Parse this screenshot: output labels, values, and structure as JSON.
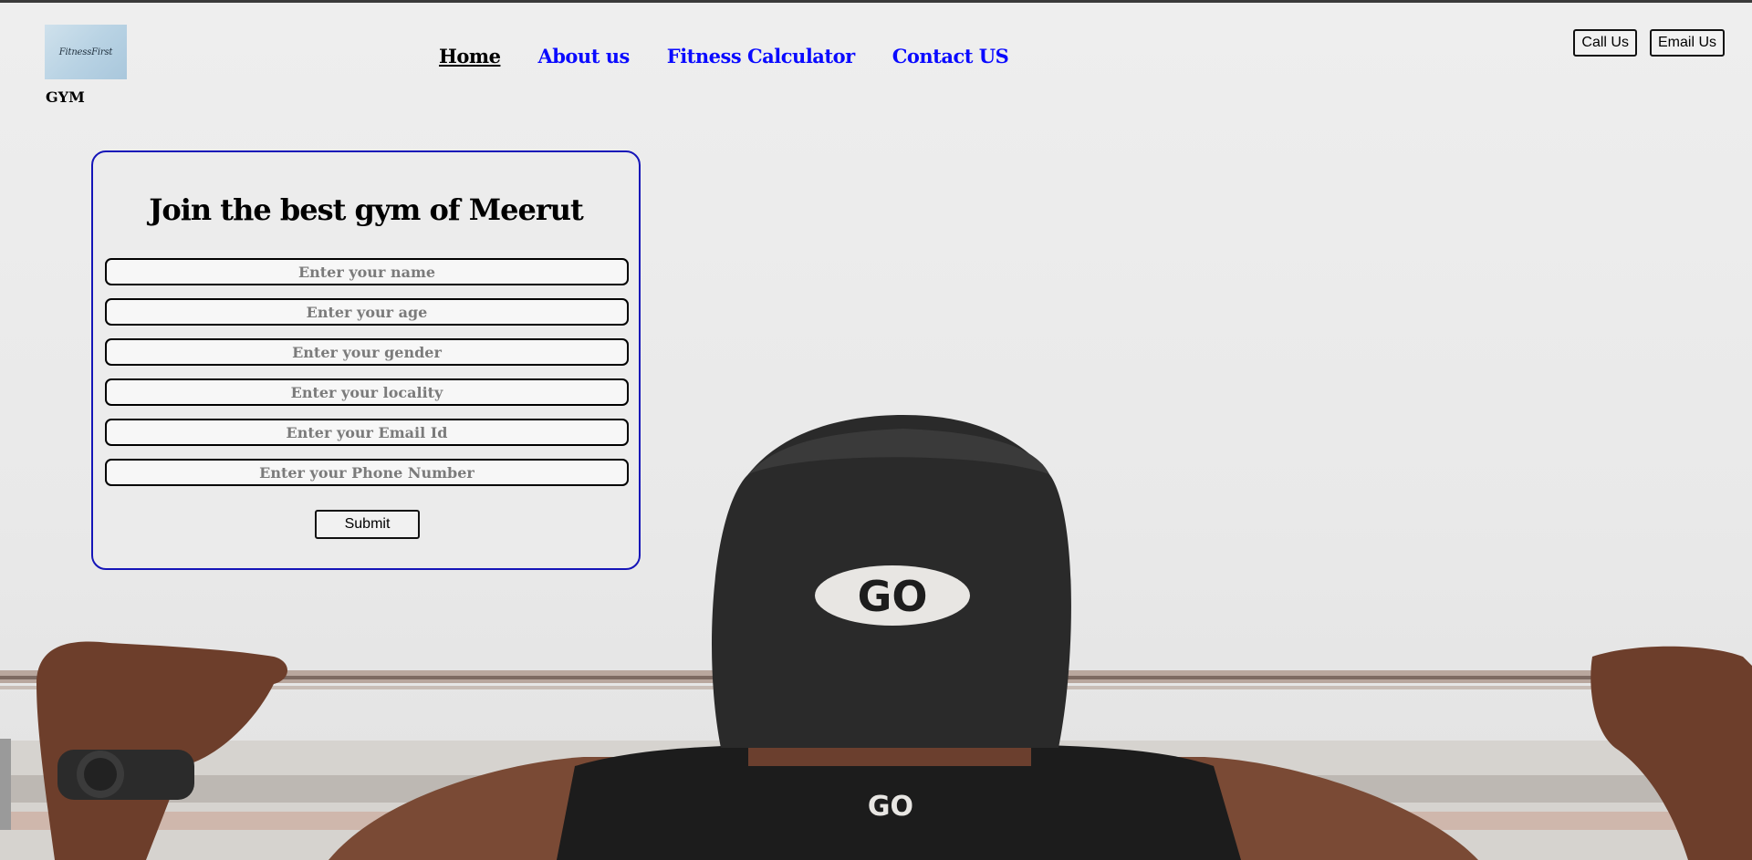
{
  "header": {
    "logo_text": "FitnessFirst",
    "brand": "GYM",
    "nav": [
      {
        "label": "Home",
        "active": true
      },
      {
        "label": "About us",
        "active": false
      },
      {
        "label": "Fitness Calculator",
        "active": false
      },
      {
        "label": "Contact US",
        "active": false
      }
    ],
    "call_label": "Call Us",
    "email_label": "Email Us"
  },
  "form": {
    "title": "Join the best gym of Meerut",
    "fields": [
      {
        "placeholder": "Enter your name",
        "value": ""
      },
      {
        "placeholder": "Enter your age",
        "value": ""
      },
      {
        "placeholder": "Enter your gender",
        "value": ""
      },
      {
        "placeholder": "Enter your locality",
        "value": ""
      },
      {
        "placeholder": "Enter your Email Id",
        "value": ""
      },
      {
        "placeholder": "Enter your Phone Number",
        "value": ""
      }
    ],
    "submit_label": "Submit"
  },
  "background": {
    "cap_logo": "GO",
    "shirt_logo": "GO"
  },
  "colors": {
    "nav_link": "#0a0aff",
    "nav_active": "#000000",
    "card_border": "#1515b8"
  }
}
